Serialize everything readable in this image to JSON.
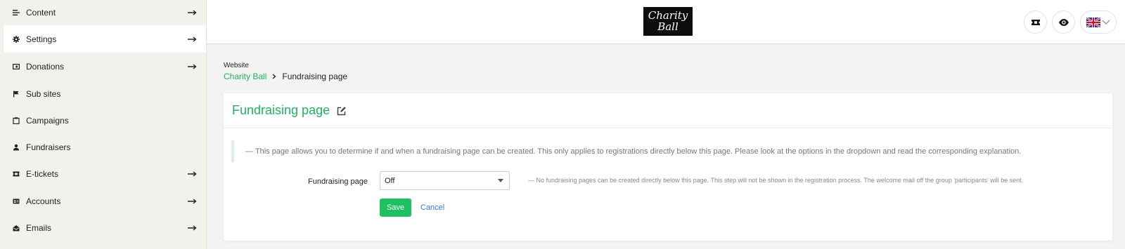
{
  "sidebar": {
    "items": [
      {
        "label": "Content",
        "icon": "list-icon",
        "has_arrow": true,
        "active": false
      },
      {
        "label": "Settings",
        "icon": "gear-icon",
        "has_arrow": true,
        "active": true
      },
      {
        "label": "Donations",
        "icon": "wallet-icon",
        "has_arrow": true,
        "active": false
      },
      {
        "label": "Sub sites",
        "icon": "flag-icon",
        "has_arrow": false,
        "active": false
      },
      {
        "label": "Campaigns",
        "icon": "clipboard-icon",
        "has_arrow": false,
        "active": false
      },
      {
        "label": "Fundraisers",
        "icon": "person-icon",
        "has_arrow": false,
        "active": false
      },
      {
        "label": "E-tickets",
        "icon": "ticket-icon",
        "has_arrow": true,
        "active": false
      },
      {
        "label": "Accounts",
        "icon": "id-card-icon",
        "has_arrow": true,
        "active": false
      },
      {
        "label": "Emails",
        "icon": "envelope-open-icon",
        "has_arrow": true,
        "active": false
      }
    ]
  },
  "topbar": {
    "logo_line1": "Charity",
    "logo_line2": "Ball"
  },
  "breadcrumb": {
    "section": "Website",
    "parent": "Charity Ball",
    "current": "Fundraising page"
  },
  "card": {
    "title": "Fundraising page",
    "info": "— This page allows you to determine if and when a fundraising page can be created. This only applies to registrations directly below this page. Please look at the options in the dropdown and read the corresponding explanation.",
    "field_label": "Fundraising page",
    "select_value": "Off",
    "hint": "— No fundraising pages can be created directly below this page. This step will not be shown in the registration process. The welcome mail off the group 'participants' will be sent.",
    "save_label": "Save",
    "cancel_label": "Cancel"
  },
  "colors": {
    "accent": "#1fb162",
    "save_button": "#1fc061",
    "link": "#2e7bd6",
    "sidebar_bg": "#f2f1ec"
  }
}
